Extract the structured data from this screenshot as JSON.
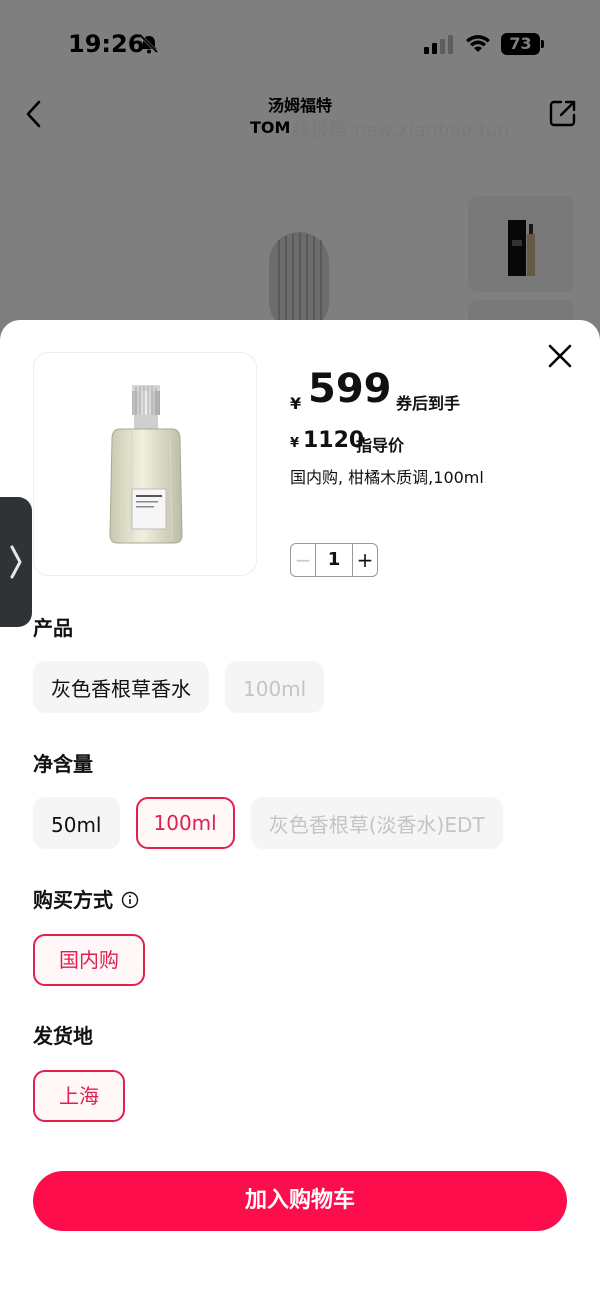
{
  "status_bar": {
    "time": "19:26",
    "battery": "73"
  },
  "nav": {
    "title_cn": "汤姆福特",
    "title_en": "TOM",
    "watermark": "线报酷-new.xianbao.fun"
  },
  "product": {
    "currency": "¥",
    "price": "599",
    "price_suffix": "券后到手",
    "guide_price": "1120",
    "guide_suffix": "指导价",
    "spec": "国内购, 柑橘木质调,100ml",
    "quantity": "1",
    "minus": "−",
    "plus": "+"
  },
  "sections": {
    "product": {
      "title": "产品",
      "options": [
        {
          "label": "灰色香根草香水",
          "state": "normal"
        },
        {
          "label": "100ml",
          "state": "disabled"
        }
      ]
    },
    "volume": {
      "title": "净含量",
      "options": [
        {
          "label": "50ml",
          "state": "normal"
        },
        {
          "label": "100ml",
          "state": "selected"
        },
        {
          "label": "灰色香根草(淡香水)EDT",
          "state": "disabled"
        }
      ]
    },
    "purchase": {
      "title": "购买方式",
      "options": [
        {
          "label": "国内购",
          "state": "selected"
        }
      ]
    },
    "ship_from": {
      "title": "发货地",
      "options": [
        {
          "label": "上海",
          "state": "selected"
        }
      ]
    }
  },
  "cart_button": "加入购物车",
  "colors": {
    "accent": "#fd0d4c",
    "selected_border": "#e0214f"
  }
}
